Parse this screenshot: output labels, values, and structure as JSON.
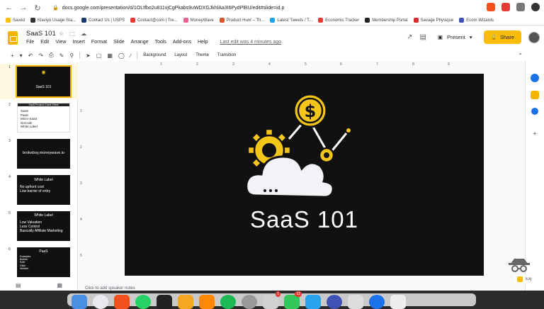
{
  "browser": {
    "url": "docs.google.com/presentation/d/1OLtfbo2u811vjCgPkabs9uWDXGJkhlAa3I6PydPlBU/edit#slide=id.p",
    "bookmarks": [
      {
        "label": "Saved",
        "color": "#fbbc04"
      },
      {
        "label": "Klaviyo Usage Sta...",
        "color": "#333333"
      },
      {
        "label": "Contact Us | USPS",
        "color": "#1a3b6e"
      },
      {
        "label": "Contact@com | Tre...",
        "color": "#e53935"
      },
      {
        "label": "MoneyWave",
        "color": "#f06292"
      },
      {
        "label": "Product Hunt – Th...",
        "color": "#da552f"
      },
      {
        "label": "Latest Tweets / T...",
        "color": "#1da1f2"
      },
      {
        "label": "Economic Tracker",
        "color": "#e53935"
      },
      {
        "label": "Membership Portal",
        "color": "#222222"
      },
      {
        "label": "Savage Physique",
        "color": "#d32f2f"
      },
      {
        "label": "Ecom Wizards",
        "color": "#3f51b5"
      }
    ]
  },
  "header": {
    "title": "SaaS 101",
    "menu": [
      "File",
      "Edit",
      "View",
      "Insert",
      "Format",
      "Slide",
      "Arrange",
      "Tools",
      "Add-ons",
      "Help"
    ],
    "last_edit": "Last edit was 4 minutes ago",
    "present_label": "Present",
    "share_label": "Share"
  },
  "toolbar": {
    "background": "Background",
    "layout": "Layout",
    "theme": "Theme",
    "transition": "Transition"
  },
  "thumbnails": [
    {
      "num": "1",
      "title": "SaaS 101",
      "lines": []
    },
    {
      "num": "2",
      "title": "SaaS Product Cheat Sheet",
      "lines": [
        "SaaS",
        "PaaS",
        "Micro-SaaS",
        "NoCode",
        "White Label"
      ]
    },
    {
      "num": "3",
      "title": "brokeboy.moneywave.io",
      "lines": []
    },
    {
      "num": "4",
      "title": "White Label",
      "lines": [
        "No upfront cost",
        "Low barrier of entry"
      ]
    },
    {
      "num": "5",
      "title": "White Label",
      "lines": [
        "Low Valuation",
        "Less Control",
        "Basically Affiliate Marketing"
      ]
    },
    {
      "num": "6",
      "title": "PaaS",
      "lines": [
        "Examples",
        "Bubble",
        "Softr",
        "Glide",
        "WeWeb"
      ]
    }
  ],
  "ruler": {
    "top": [
      "1",
      "2",
      "3",
      "4",
      "5",
      "6",
      "7",
      "8",
      "9"
    ],
    "left": [
      "1",
      "2",
      "3",
      "4",
      "5"
    ]
  },
  "slide": {
    "title": "SaaS 101"
  },
  "notes_placeholder": "Click to add speaker notes",
  "explore_label": "Explore",
  "colors": {
    "accent": "#fbbc04",
    "slide_bg": "#111111",
    "gear": "#f5c518"
  }
}
